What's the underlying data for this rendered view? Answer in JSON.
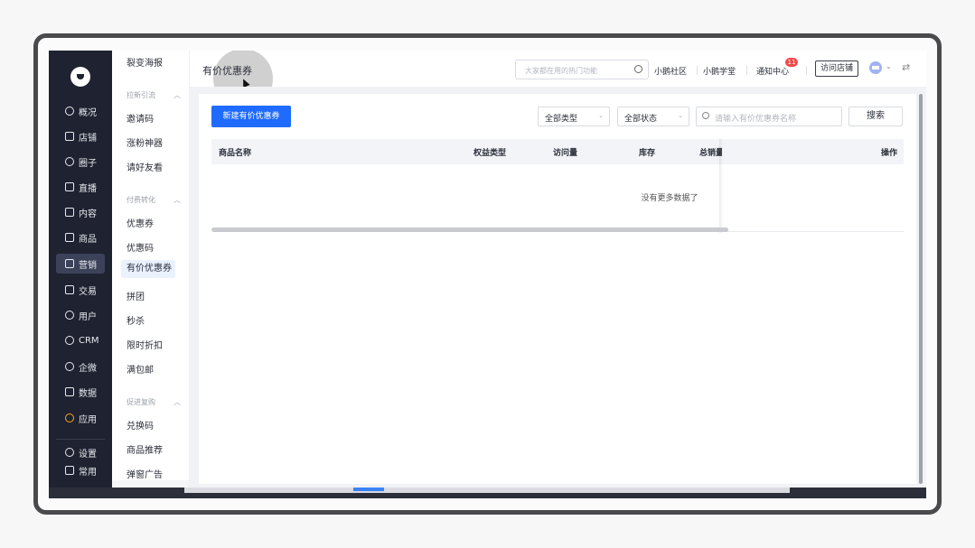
{
  "rail": {
    "items": [
      {
        "label": "概况",
        "icon": "pie-chart-icon"
      },
      {
        "label": "店铺",
        "icon": "store-icon"
      },
      {
        "label": "圈子",
        "icon": "people-icon"
      },
      {
        "label": "直播",
        "icon": "live-icon"
      },
      {
        "label": "内容",
        "icon": "document-icon"
      },
      {
        "label": "商品",
        "icon": "box-icon"
      },
      {
        "label": "营销",
        "icon": "megaphone-icon"
      },
      {
        "label": "交易",
        "icon": "trade-icon"
      },
      {
        "label": "用户",
        "icon": "user-icon"
      },
      {
        "label": "CRM",
        "icon": "crm-icon"
      },
      {
        "label": "企微",
        "icon": "wecom-icon"
      },
      {
        "label": "数据",
        "icon": "data-icon"
      },
      {
        "label": "应用",
        "icon": "apps-icon"
      }
    ],
    "bottom": [
      {
        "label": "设置",
        "icon": "gear-icon"
      },
      {
        "label": "常用",
        "icon": "list-icon"
      }
    ],
    "active": "营销"
  },
  "submenu": {
    "top_item": "裂变海报",
    "groups": [
      {
        "title": "拉新引流",
        "items": [
          "邀请码",
          "涨粉神器",
          "请好友看"
        ]
      },
      {
        "title": "付费转化",
        "items": [
          "优惠券",
          "优惠码",
          "有价优惠券",
          "拼团",
          "秒杀",
          "限时折扣",
          "满包邮"
        ]
      },
      {
        "title": "促进复购",
        "items": [
          "兑换码",
          "商品推荐",
          "弹窗广告"
        ]
      }
    ],
    "active": "有价优惠券"
  },
  "header": {
    "page_title": "有价优惠券",
    "search_placeholder": "大家都在用的热门功能",
    "links": [
      "小鹅社区",
      "小鹅学堂",
      "通知中心"
    ],
    "notification_count": "11",
    "visit_store": "访问店铺"
  },
  "toolbar": {
    "new_button": "新建有价优惠券",
    "type_filter": "全部类型",
    "status_filter": "全部状态",
    "search_placeholder": "请输入有价优惠券名称",
    "search_button": "搜索"
  },
  "table": {
    "columns": [
      "商品名称",
      "权益类型",
      "访问量",
      "库存",
      "总销量",
      "操作"
    ],
    "empty_text": "没有更多数据了"
  },
  "colors": {
    "rail_bg": "#1f2230",
    "primary": "#1f6bff",
    "badge": "#f04b4b"
  }
}
